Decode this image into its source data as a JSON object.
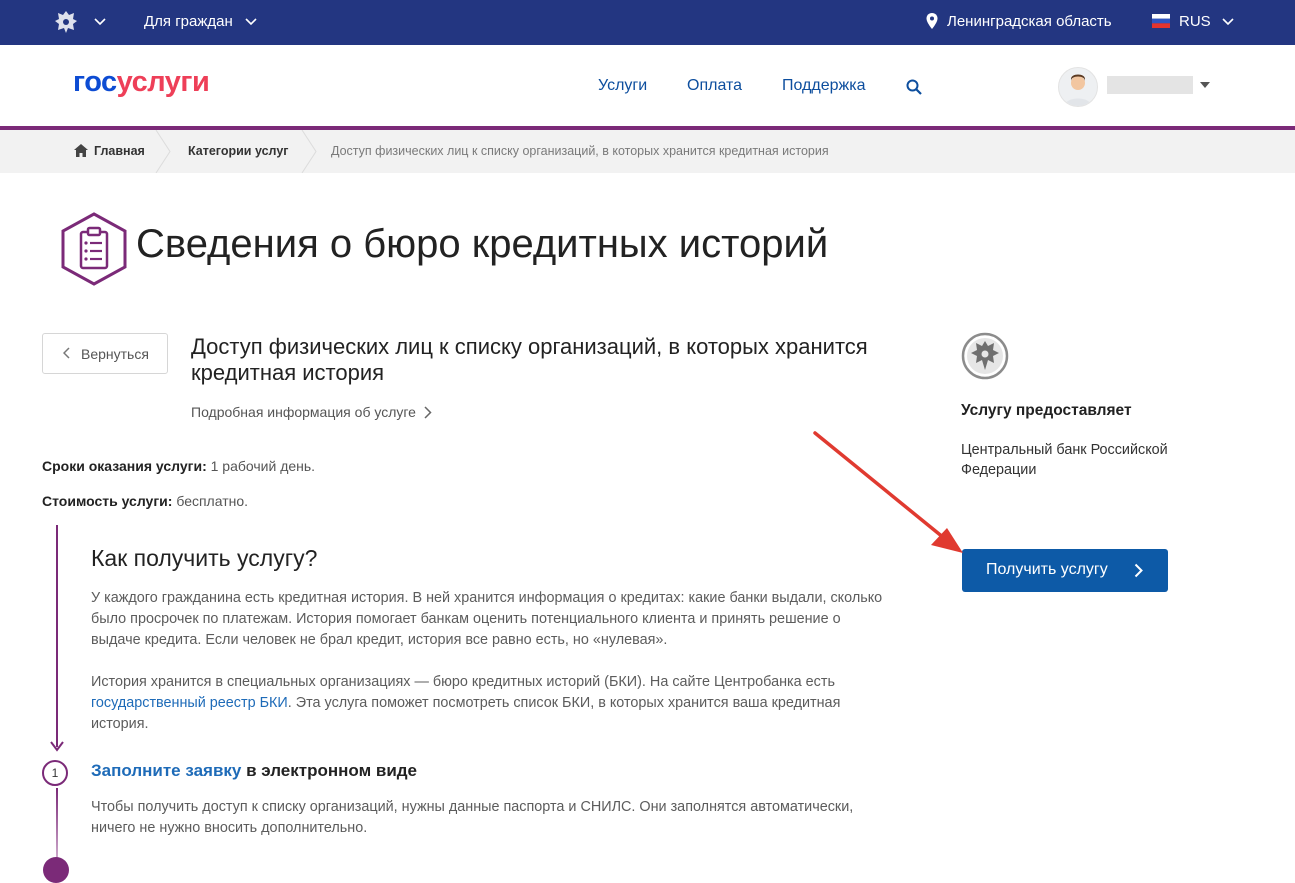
{
  "topbar": {
    "audience_label": "Для граждан",
    "region": "Ленинградская область",
    "language": "RUS"
  },
  "header": {
    "logo_part1": "гос",
    "logo_part2": "услуги",
    "nav": [
      "Услуги",
      "Оплата",
      "Поддержка"
    ]
  },
  "breadcrumbs": {
    "home": "Главная",
    "categories": "Категории услуг",
    "current": "Доступ физических лиц к списку организаций, в которых хранится кредитная история"
  },
  "page": {
    "title": "Сведения о бюро кредитных историй",
    "back_label": "Вернуться",
    "service_title": "Доступ физических лиц к списку организаций, в которых хранится кредитная история",
    "more_info": "Подробная информация об услуге",
    "term_label": "Сроки оказания услуги:",
    "term_value": " 1 рабочий день.",
    "cost_label": "Стоимость услуги:",
    "cost_value": " бесплатно."
  },
  "how": {
    "title": "Как получить услугу?",
    "para1": "У каждого гражданина есть кредитная история. В ней хранится информация о кредитах: какие банки выдали, сколько было просрочек по платежам. История помогает банкам оценить потенциального клиента и принять решение о выдаче кредита. Если человек не брал кредит, история все равно есть, но «нулевая».",
    "para2_before": "История хранится в специальных организациях — бюро кредитных историй (БКИ). На сайте Центробанка есть ",
    "para2_link": "государственный реестр БКИ",
    "para2_after": ". Эта услуга поможет посмотреть список БКИ, в которых хранится ваша кредитная история."
  },
  "steps": [
    {
      "number": "1",
      "title_link": "Заполните заявку",
      "title_rest": " в электронном виде",
      "text": "Чтобы получить доступ к списку организаций, нужны данные паспорта и СНИЛС. Они заполнятся автоматически, ничего не нужно вносить дополнительно."
    }
  ],
  "sidebar": {
    "provider_label": "Услугу предоставляет",
    "provider_name": "Центральный банк Российской Федерации",
    "get_button": "Получить услугу"
  },
  "colors": {
    "topbar": "#233681",
    "accent_purple": "#7b2a78",
    "button_blue": "#0d5aa7",
    "link_blue": "#1e6bb8",
    "annotation_red": "#e03a30"
  }
}
